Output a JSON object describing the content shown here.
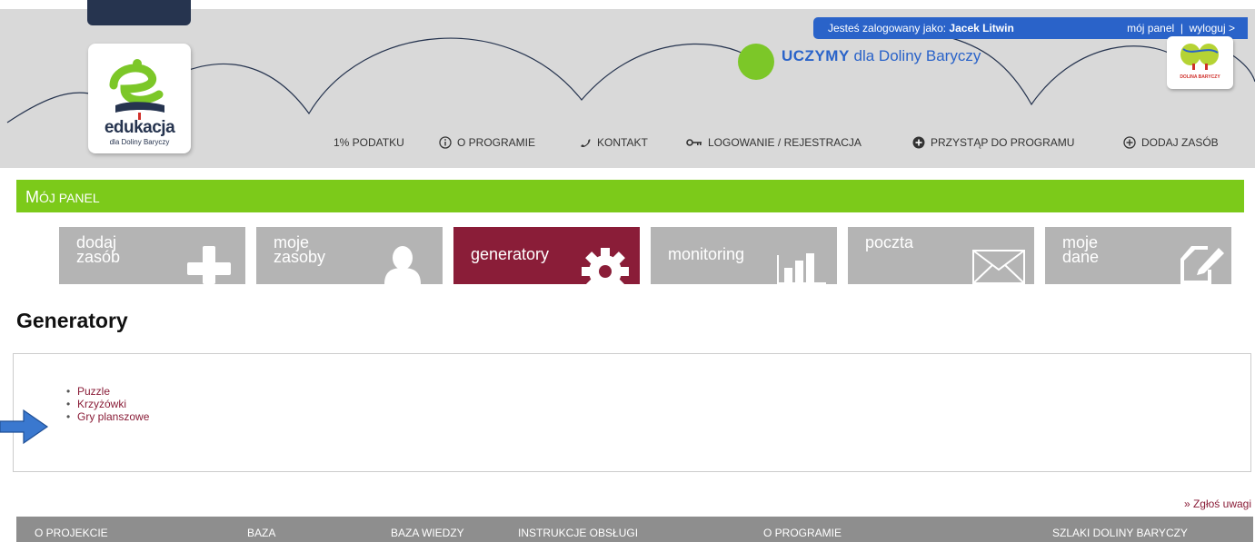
{
  "header": {
    "logo_title": "edukacja",
    "logo_subtitle": "dla Doliny Baryczy",
    "login_prefix": "Jesteś zalogowany jako:",
    "login_user": "Jacek Litwin",
    "my_panel_link": "mój panel",
    "separator": "|",
    "logout_link": "wyloguj >",
    "slogan_bold": "UCZYMY",
    "slogan_rest": "dla Doliny Baryczy",
    "barycz_logo_text": "DOLINA BARYCZY"
  },
  "topnav": {
    "items": [
      {
        "label": "1% PODATKU",
        "icon": ""
      },
      {
        "label": "O PROGRAMIE",
        "icon": "info-icon"
      },
      {
        "label": "KONTAKT",
        "icon": "phone-icon"
      },
      {
        "label": "LOGOWANIE / REJESTRACJA",
        "icon": "key-icon"
      },
      {
        "label": "PRZYSTĄP DO PROGRAMU",
        "icon": "plus-filled-icon"
      },
      {
        "label": "DODAJ ZASÓB",
        "icon": "plus-outline-icon"
      }
    ]
  },
  "panel": {
    "title_first": "M",
    "title_rest": "ÓJ PANEL"
  },
  "tiles": [
    {
      "line1": "dodaj",
      "line2": "zasób",
      "icon": "plus-icon",
      "active": false
    },
    {
      "line1": "moje",
      "line2": "zasoby",
      "icon": "user-icon",
      "active": false
    },
    {
      "line1": "generatory",
      "line2": "",
      "icon": "gear-icon",
      "active": true
    },
    {
      "line1": "monitoring",
      "line2": "",
      "icon": "bar-chart-icon",
      "active": false
    },
    {
      "line1": "poczta",
      "line2": "",
      "icon": "envelope-icon",
      "active": false
    },
    {
      "line1": "moje",
      "line2": "dane",
      "icon": "edit-icon",
      "active": false
    }
  ],
  "main": {
    "title": "Generatory",
    "generators": [
      "Puzzle",
      "Krzyżówki",
      "Gry planszowe"
    ]
  },
  "feedback_link": "» Zgłoś uwagi",
  "footer": {
    "columns": [
      "O PROJEKCIE",
      "BAZA",
      "BAZA WIEDZY",
      "INSTRUKCJE OBSŁUGI",
      "O PROGRAMIE",
      "SZLAKI DOLINY BARYCZY"
    ]
  },
  "colors": {
    "accent_green": "#7cca1a",
    "active_tile": "#8a1d38",
    "tile_gray": "#b4b4b4",
    "login_blue": "#2a63c9",
    "footer_gray": "#8e8e8e"
  }
}
